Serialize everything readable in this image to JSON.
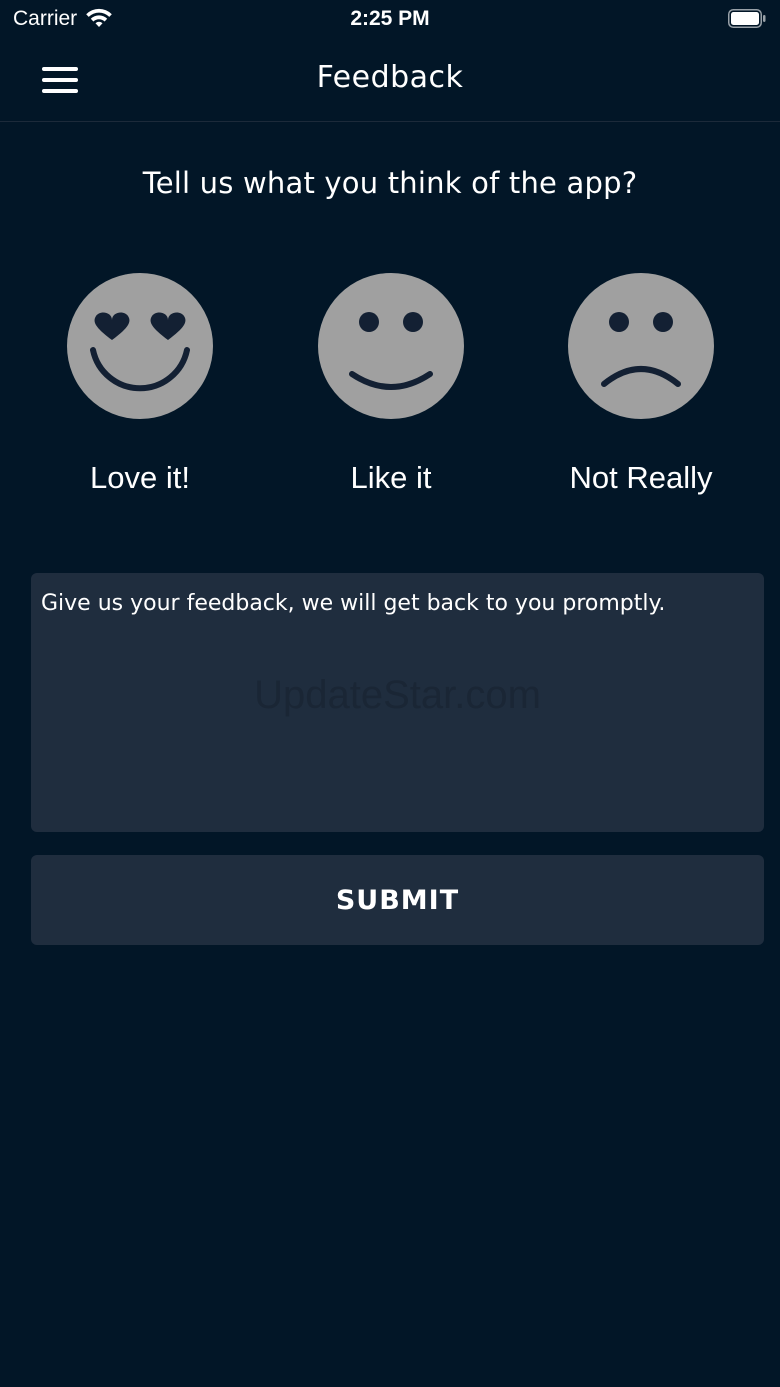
{
  "status_bar": {
    "carrier": "Carrier",
    "time": "2:25 PM"
  },
  "nav": {
    "title": "Feedback",
    "menu_icon": "hamburger-menu-icon"
  },
  "question": "Tell us what you think of the app?",
  "ratings": [
    {
      "label": "Love it!",
      "icon": "heart-eyes-face-icon"
    },
    {
      "label": "Like it",
      "icon": "smiling-face-icon"
    },
    {
      "label": "Not Really",
      "icon": "frowning-face-icon"
    }
  ],
  "feedback": {
    "placeholder": "Give us your feedback, we will get back to you promptly.",
    "value": ""
  },
  "watermark": "UpdateStar.com",
  "submit_label": "SUBMIT",
  "colors": {
    "background": "#021627",
    "surface": "#1f2d3e",
    "face": "#a0a0a0",
    "face_features": "#132033",
    "text": "#ffffff"
  }
}
